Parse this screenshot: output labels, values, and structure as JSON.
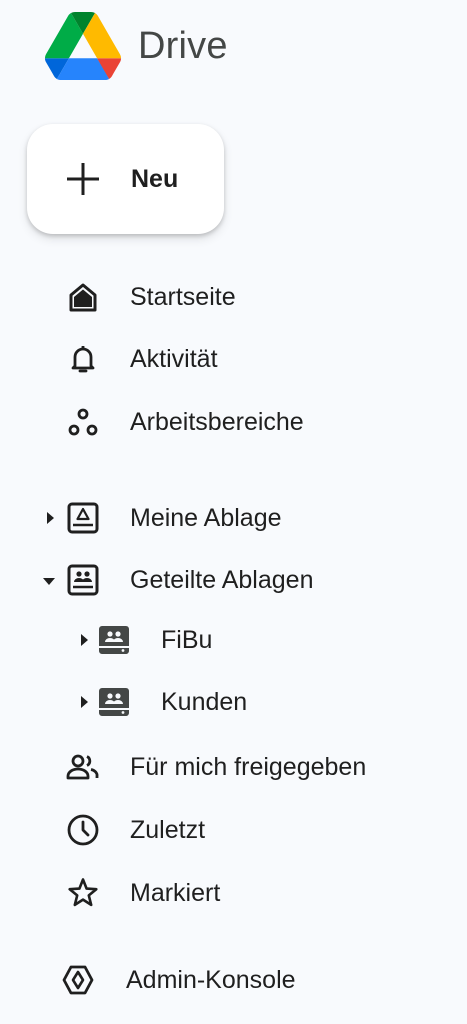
{
  "app": {
    "title": "Drive"
  },
  "new_button": {
    "label": "Neu"
  },
  "nav": {
    "home": "Startseite",
    "activity": "Aktivität",
    "workspaces": "Arbeitsbereiche",
    "my_drive": "Meine Ablage",
    "shared_drives": "Geteilte Ablagen",
    "shared_drive_items": [
      {
        "label": "FiBu"
      },
      {
        "label": "Kunden"
      }
    ],
    "shared_with_me": "Für mich freigegeben",
    "recent": "Zuletzt",
    "starred": "Markiert",
    "admin_console": "Admin-Konsole"
  },
  "icons": {
    "home": "home-icon",
    "activity": "bell-icon",
    "workspaces": "workspaces-icon",
    "my_drive": "my-drive-icon",
    "shared_drives": "shared-drive-icon",
    "shared_with_me": "people-icon",
    "recent": "clock-icon",
    "starred": "star-icon",
    "admin_console": "admin-icon"
  },
  "colors": {
    "background": "#f8fafd",
    "text": "#1f1f1f",
    "logo_green": "#0f9d58",
    "logo_yellow": "#ffba00",
    "logo_blue": "#4285f4",
    "logo_red": "#ea4335",
    "logo_dark_green": "#00832d",
    "logo_dark_blue": "#2684fc"
  }
}
